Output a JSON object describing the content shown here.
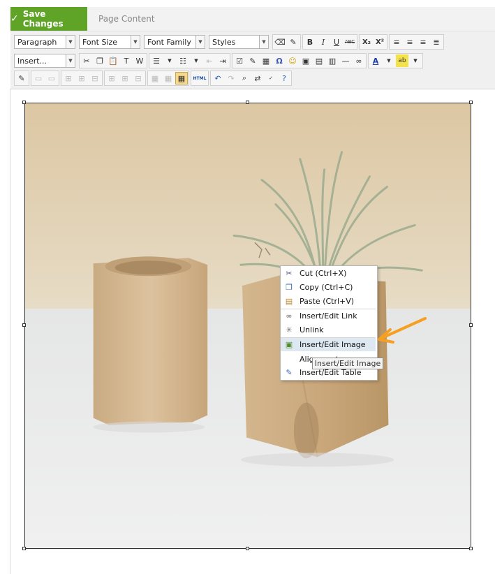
{
  "header": {
    "save_label": "Save Changes",
    "tab_label": "Page Content"
  },
  "toolbar": {
    "row1": {
      "paragraph": "Paragraph",
      "font_size": "Font Size",
      "font_family": "Font Family",
      "styles": "Styles",
      "bold": "B",
      "italic": "I",
      "underline": "U",
      "strike": "ABC",
      "subscript": "X₂",
      "superscript": "X²"
    },
    "row2": {
      "insert": "Insert...",
      "special_char": "Ω"
    },
    "row3": {
      "html": "HTML"
    }
  },
  "context_menu": {
    "items": [
      {
        "label": "Cut (Ctrl+X)",
        "icon": "scissors-icon"
      },
      {
        "label": "Copy (Ctrl+C)",
        "icon": "copy-icon"
      },
      {
        "label": "Paste (Ctrl+V)",
        "icon": "paste-icon"
      },
      {
        "label": "Insert/Edit Link",
        "icon": "link-icon"
      },
      {
        "label": "Unlink",
        "icon": "unlink-icon"
      },
      {
        "label": "Insert/Edit Image",
        "icon": "image-icon"
      },
      {
        "label": "Alignment",
        "icon": ""
      },
      {
        "label": "Insert/Edit Table",
        "icon": "table-icon"
      }
    ],
    "highlighted": "Insert/Edit Image"
  },
  "tooltip": "Insert/Edit Image",
  "colors": {
    "save_green": "#5fa427",
    "highlight": "#dde8f0",
    "arrow_orange": "#f5a023"
  }
}
